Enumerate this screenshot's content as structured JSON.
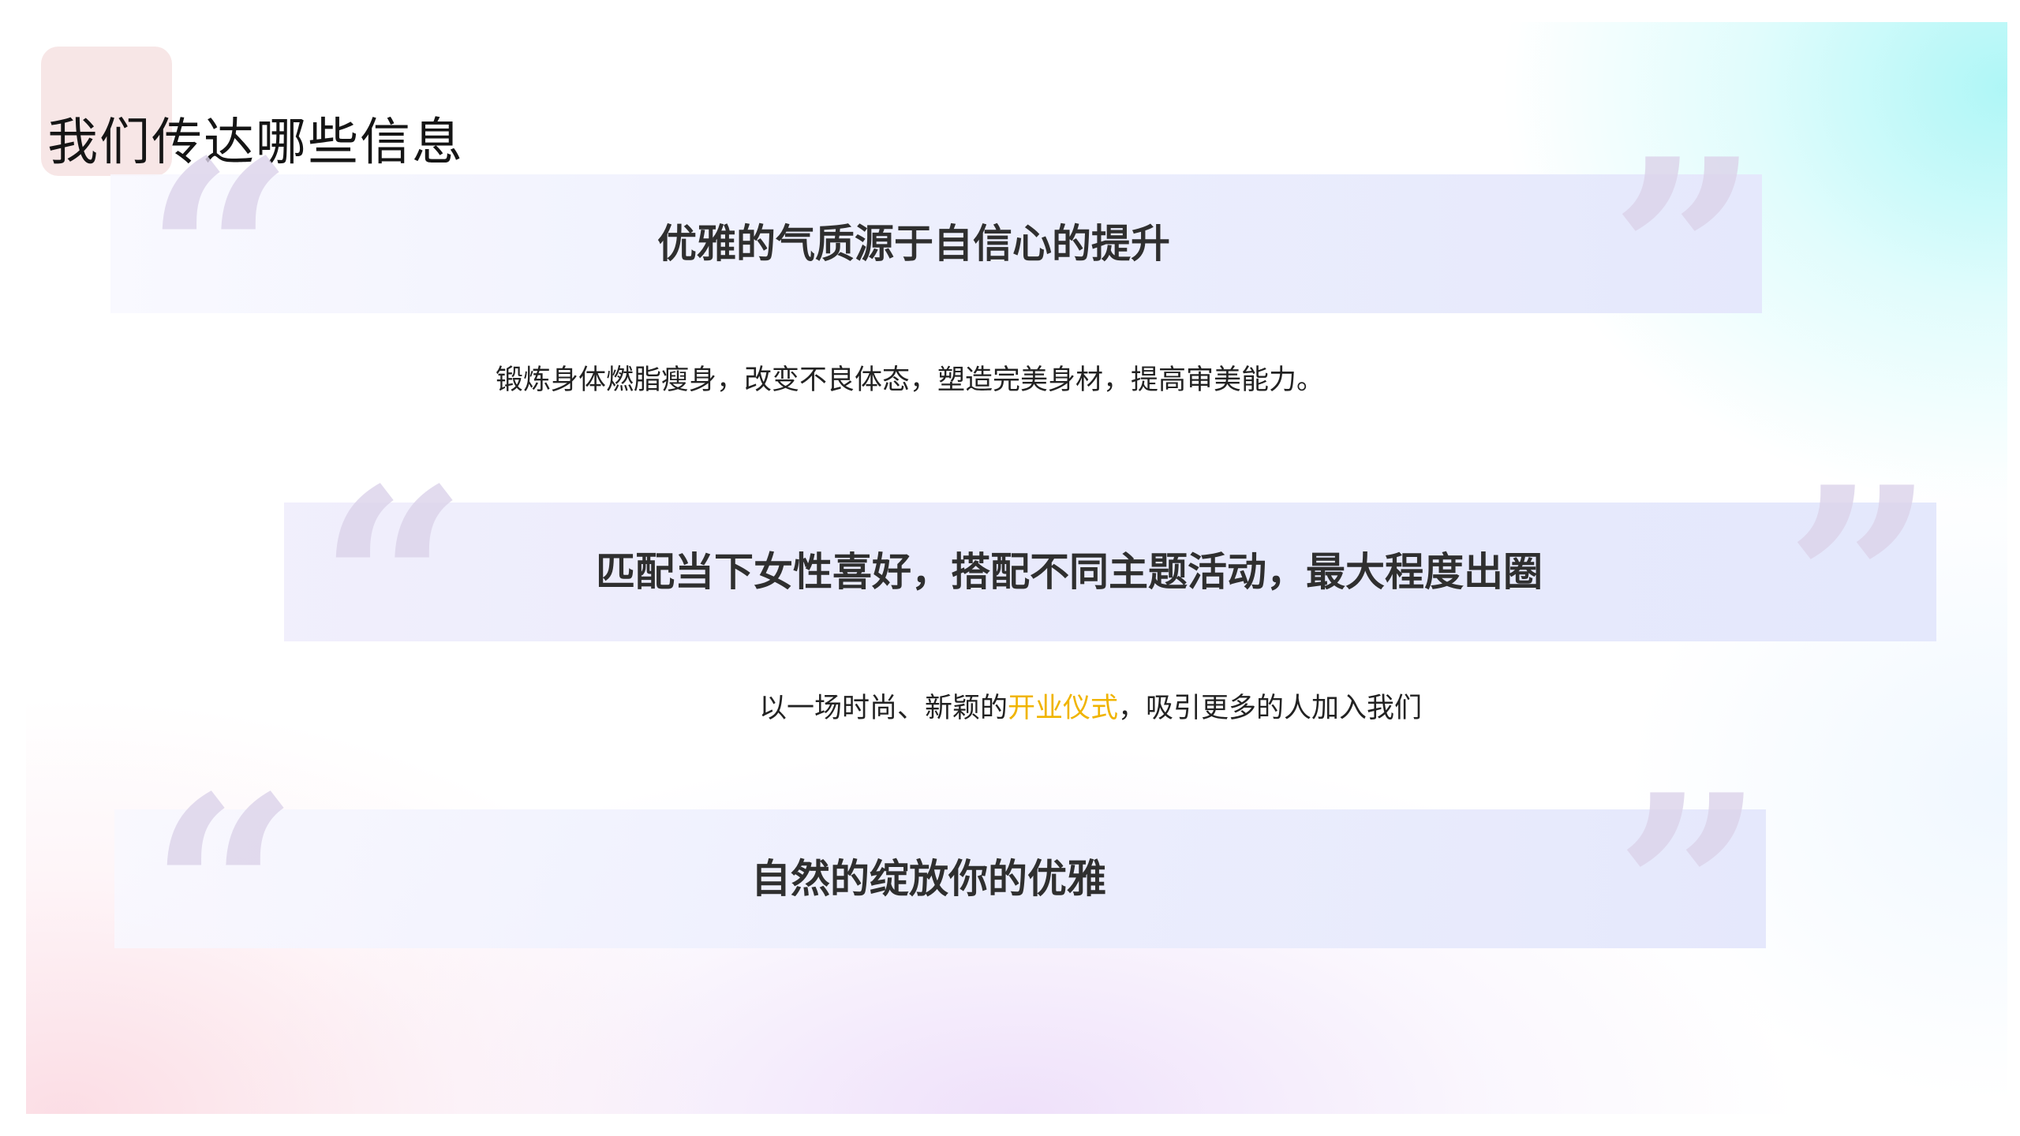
{
  "slide": {
    "title": "我们传达哪些信息",
    "colors": {
      "accent_title_block": "#f7e6e6",
      "quote_mark": "#dcd3ea",
      "band": "#e5e8fc",
      "highlight": "#f0b400",
      "heading_text": "#2f2f2f",
      "body_text": "#222222"
    },
    "sections": [
      {
        "heading": "优雅的气质源于自信心的提升",
        "body": "锻炼身体燃脂瘦身，改变不良体态，塑造完美身材，提高审美能力。"
      },
      {
        "heading": "匹配当下女性喜好，搭配不同主题活动，最大程度出圈",
        "body_before": "以一场时尚、新颖的",
        "body_highlight": "开业仪式",
        "body_after": "，吸引更多的人加入我们"
      },
      {
        "heading": "自然的绽放你的优雅"
      }
    ],
    "quote_open": "“",
    "quote_close": "”"
  }
}
